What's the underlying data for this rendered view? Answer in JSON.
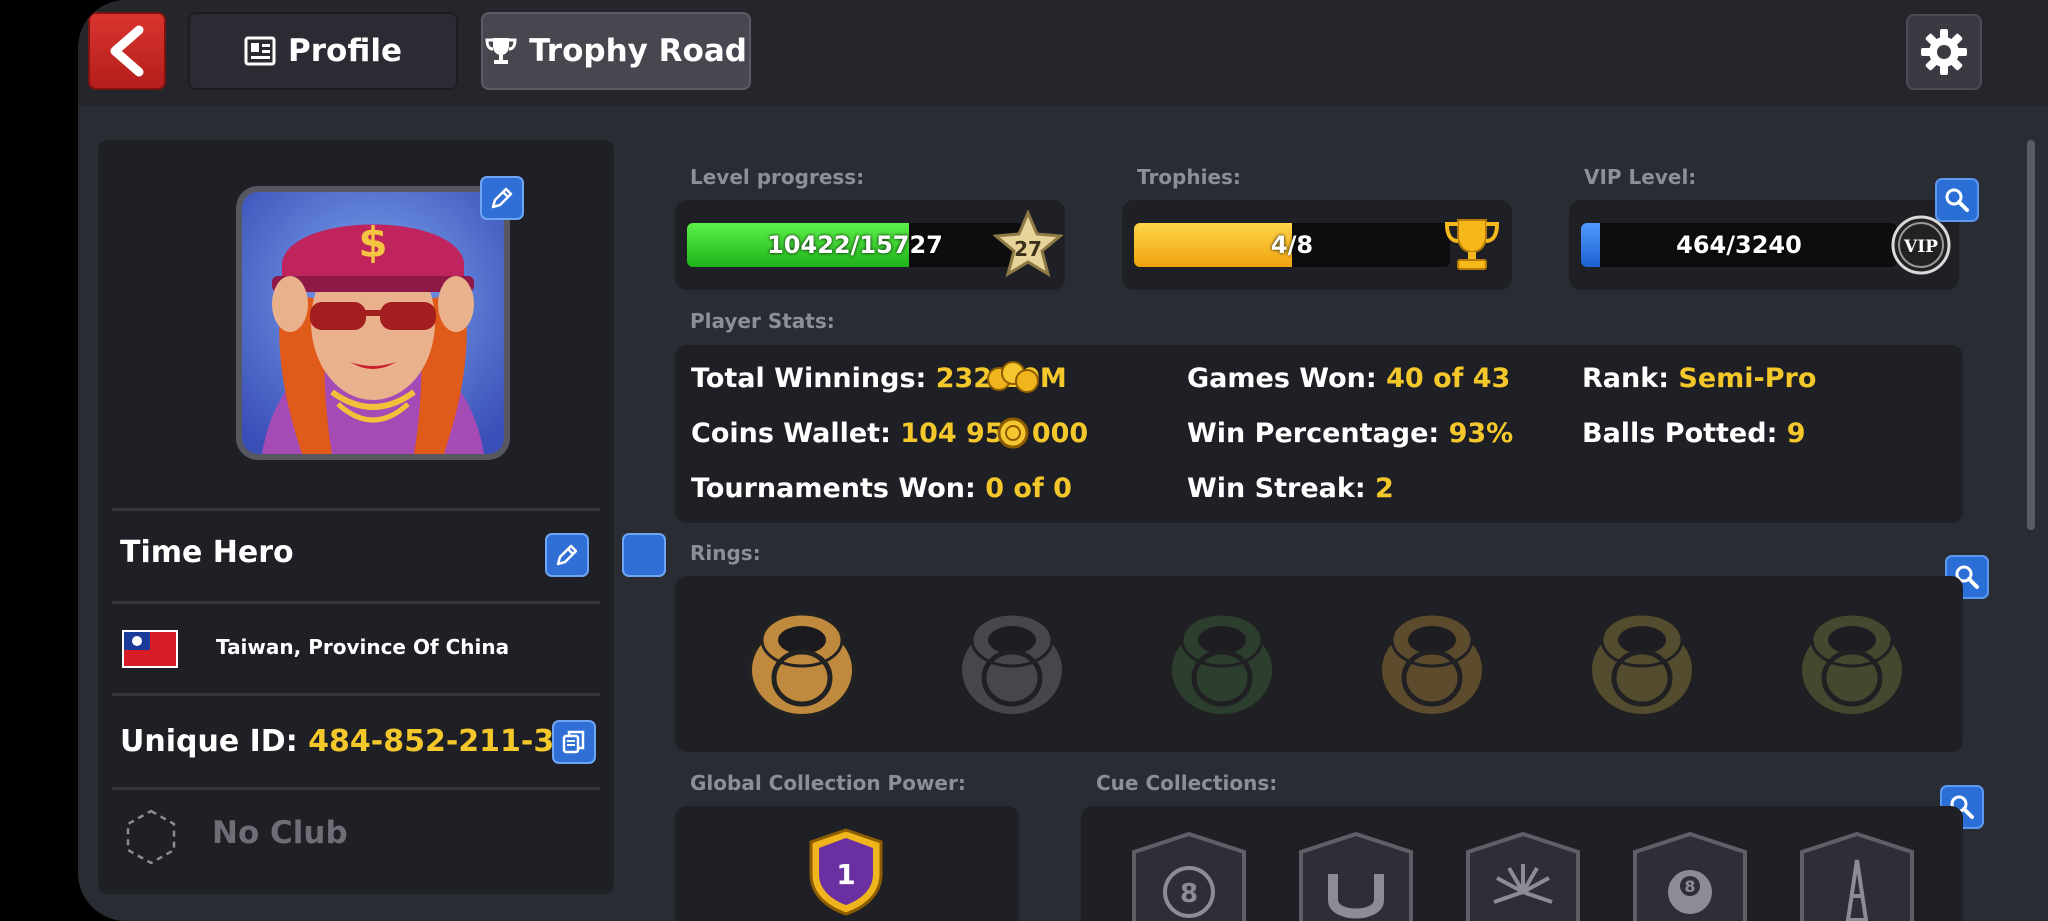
{
  "topbar": {
    "back_icon": "chevron-left-icon",
    "tabs": [
      {
        "label": "Profile",
        "icon": "profile-card-icon",
        "active": false
      },
      {
        "label": "Trophy Road",
        "icon": "trophy-icon",
        "active": true
      }
    ],
    "settings_icon": "gear-icon"
  },
  "profile": {
    "name": "Time Hero",
    "country": "Taiwan, Province Of China",
    "unique_id_label": "Unique ID:",
    "unique_id": "484-852-211-3",
    "club": "No Club"
  },
  "stats": {
    "level_progress_label": "Level progress:",
    "level_progress_value": "10422/15727",
    "level_progress_fraction": 0.66,
    "level": "27",
    "trophies_label": "Trophies:",
    "trophies_value": "4/8",
    "trophies_fraction": 0.5,
    "vip_label": "VIP Level:",
    "vip_value": "464/3240",
    "vip_fraction": 0.06,
    "vip_badge": "VIP",
    "player_stats_label": "Player Stats:",
    "items": [
      {
        "label": "Total Winnings:",
        "value": "232.10M"
      },
      {
        "label": "Games Won:",
        "value": "40 of 43"
      },
      {
        "label": "Rank:",
        "value": "Semi-Pro"
      },
      {
        "label": "Coins Wallet:",
        "value": "104 950 000"
      },
      {
        "label": "Win Percentage:",
        "value": "93%"
      },
      {
        "label": "Balls Potted:",
        "value": "9"
      },
      {
        "label": "Tournaments Won:",
        "value": "0 of 0"
      },
      {
        "label": "Win Streak:",
        "value": "2"
      }
    ]
  },
  "rings_label": "Rings:",
  "rings": [
    {
      "name": "Legend ring",
      "unlocked": true,
      "color": "#c08a3e"
    },
    {
      "name": "Silver ring",
      "unlocked": false,
      "color": "#7c7d86"
    },
    {
      "name": "Green gem ring",
      "unlocked": false,
      "color": "#3e6a3c"
    },
    {
      "name": "Lisbon ring",
      "unlocked": false,
      "color": "#b08a3a"
    },
    {
      "name": "Island ring",
      "unlocked": false,
      "color": "#9d8a3e"
    },
    {
      "name": "Gold dome ring",
      "unlocked": false,
      "color": "#7a7d3c"
    }
  ],
  "global_collection_label": "Global Collection Power:",
  "global_collection_value": "1",
  "cue_collections_label": "Cue Collections:",
  "cue_collections": [
    "pixel-8ball-icon",
    "horseshoe-icon",
    "fireworks-icon",
    "laurel-8ball-icon",
    "paris-icon"
  ],
  "colors": {
    "accent_yellow": "#f4c82a",
    "level_green": "#2fcf2a",
    "trophy_orange": "#f5b820",
    "vip_blue": "#2f7be4"
  }
}
